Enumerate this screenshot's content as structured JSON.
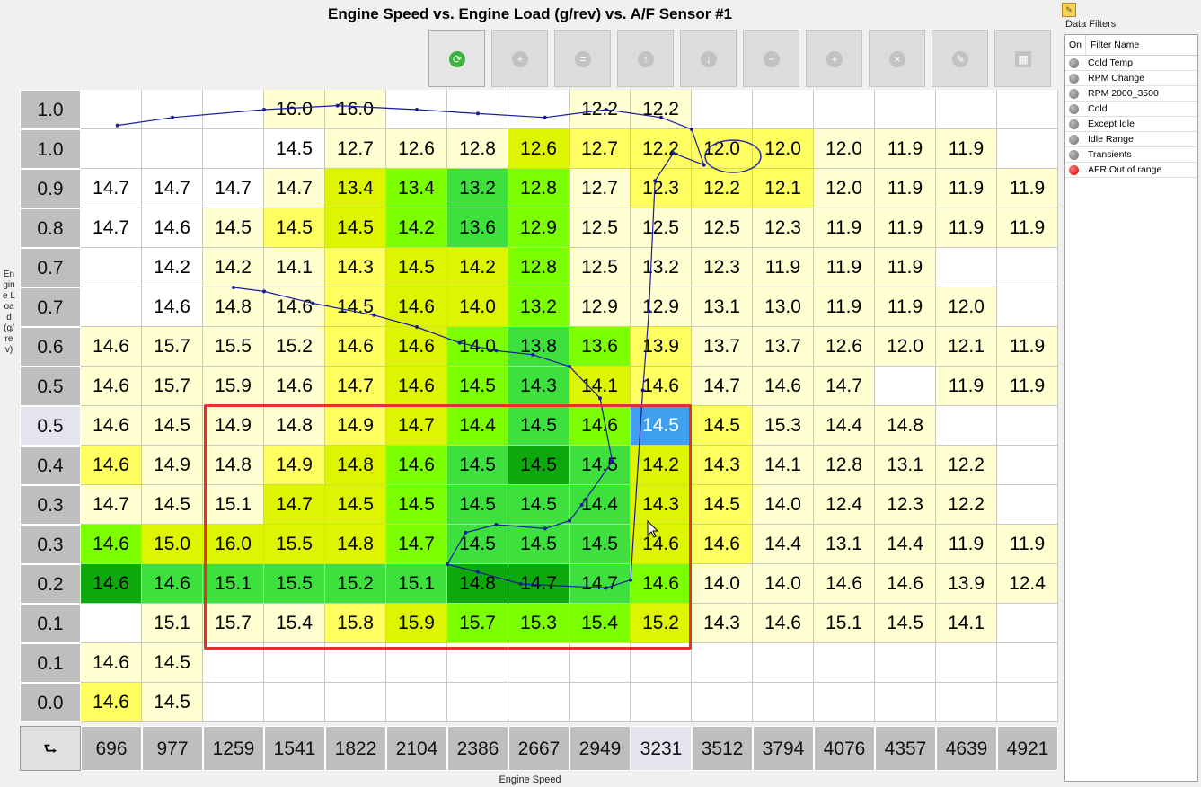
{
  "title": "Engine Speed vs. Engine Load  (g/rev) vs. A/F Sensor #1",
  "y_axis_label": "Engine Load (g/rev)",
  "x_axis_label": "Engine Speed",
  "corner_symbol": "⮑",
  "toolbar_buttons": [
    {
      "name": "refresh",
      "icon": "refresh-icon",
      "glyph": "⟳",
      "enabled": true
    },
    {
      "name": "add",
      "icon": "add-icon",
      "glyph": "+",
      "enabled": false
    },
    {
      "name": "equals",
      "icon": "equals-icon",
      "glyph": "=",
      "enabled": false
    },
    {
      "name": "move-up",
      "icon": "arrow-up-icon",
      "glyph": "↑",
      "enabled": false
    },
    {
      "name": "move-down",
      "icon": "arrow-down-icon",
      "glyph": "↓",
      "enabled": false
    },
    {
      "name": "subtract",
      "icon": "minus-icon",
      "glyph": "−",
      "enabled": false
    },
    {
      "name": "increase",
      "icon": "plus-icon",
      "glyph": "+",
      "enabled": false
    },
    {
      "name": "clear",
      "icon": "close-icon",
      "glyph": "×",
      "enabled": false
    },
    {
      "name": "edit",
      "icon": "pencil-icon",
      "glyph": "✎",
      "enabled": false
    },
    {
      "name": "table",
      "icon": "table-icon",
      "glyph": "▦",
      "enabled": false
    }
  ],
  "row_labels": [
    "1.0",
    "1.0",
    "0.9",
    "0.8",
    "0.7",
    "0.7",
    "0.6",
    "0.5",
    "0.5",
    "0.4",
    "0.3",
    "0.3",
    "0.2",
    "0.1",
    "0.1",
    "0.0"
  ],
  "col_labels": [
    "696",
    "977",
    "1259",
    "1541",
    "1822",
    "2104",
    "2386",
    "2667",
    "2949",
    "3231",
    "3512",
    "3794",
    "4076",
    "4357",
    "4639",
    "4921"
  ],
  "highlight_row": 8,
  "highlight_col": 9,
  "cells": [
    [
      "",
      "",
      "",
      "16.0",
      "16.0",
      "",
      "",
      "",
      "12.2",
      "12.2",
      "",
      "",
      "",
      "",
      "",
      ""
    ],
    [
      "",
      "",
      "",
      "14.5",
      "12.7",
      "12.6",
      "12.8",
      "12.6",
      "12.7",
      "12.2",
      "12.0",
      "12.0",
      "12.0",
      "11.9",
      "11.9",
      ""
    ],
    [
      "14.7",
      "14.7",
      "14.7",
      "14.7",
      "13.4",
      "13.4",
      "13.2",
      "12.8",
      "12.7",
      "12.3",
      "12.2",
      "12.1",
      "12.0",
      "11.9",
      "11.9",
      "11.9"
    ],
    [
      "14.7",
      "14.6",
      "14.5",
      "14.5",
      "14.5",
      "14.2",
      "13.6",
      "12.9",
      "12.5",
      "12.5",
      "12.5",
      "12.3",
      "11.9",
      "11.9",
      "11.9",
      "11.9"
    ],
    [
      "",
      "14.2",
      "14.2",
      "14.1",
      "14.3",
      "14.5",
      "14.2",
      "12.8",
      "12.5",
      "13.2",
      "12.3",
      "11.9",
      "11.9",
      "11.9",
      "",
      ""
    ],
    [
      "",
      "14.6",
      "14.8",
      "14.6",
      "14.5",
      "14.6",
      "14.0",
      "13.2",
      "12.9",
      "12.9",
      "13.1",
      "13.0",
      "11.9",
      "11.9",
      "12.0",
      ""
    ],
    [
      "14.6",
      "15.7",
      "15.5",
      "15.2",
      "14.6",
      "14.6",
      "14.0",
      "13.8",
      "13.6",
      "13.9",
      "13.7",
      "13.7",
      "12.6",
      "12.0",
      "12.1",
      "11.9"
    ],
    [
      "14.6",
      "15.7",
      "15.9",
      "14.6",
      "14.7",
      "14.6",
      "14.5",
      "14.3",
      "14.1",
      "14.6",
      "14.7",
      "14.6",
      "14.7",
      "",
      "11.9",
      "11.9"
    ],
    [
      "14.6",
      "14.5",
      "14.9",
      "14.8",
      "14.9",
      "14.7",
      "14.4",
      "14.5",
      "14.6",
      "14.5",
      "14.5",
      "15.3",
      "14.4",
      "14.8",
      "",
      ""
    ],
    [
      "14.6",
      "14.9",
      "14.8",
      "14.9",
      "14.8",
      "14.6",
      "14.5",
      "14.5",
      "14.5",
      "14.2",
      "14.3",
      "14.1",
      "12.8",
      "13.1",
      "12.2",
      ""
    ],
    [
      "14.7",
      "14.5",
      "15.1",
      "14.7",
      "14.5",
      "14.5",
      "14.5",
      "14.5",
      "14.4",
      "14.3",
      "14.5",
      "14.0",
      "12.4",
      "12.3",
      "12.2",
      ""
    ],
    [
      "14.6",
      "15.0",
      "16.0",
      "15.5",
      "14.8",
      "14.7",
      "14.5",
      "14.5",
      "14.5",
      "14.6",
      "14.6",
      "14.4",
      "13.1",
      "14.4",
      "11.9",
      "11.9"
    ],
    [
      "14.6",
      "14.6",
      "15.1",
      "15.5",
      "15.2",
      "15.1",
      "14.8",
      "14.7",
      "14.7",
      "14.6",
      "14.0",
      "14.0",
      "14.6",
      "14.6",
      "13.9",
      "12.4"
    ],
    [
      "",
      "15.1",
      "15.7",
      "15.4",
      "15.8",
      "15.9",
      "15.7",
      "15.3",
      "15.4",
      "15.2",
      "14.3",
      "14.6",
      "15.1",
      "14.5",
      "14.1",
      ""
    ],
    [
      "14.6",
      "14.5",
      "",
      "",
      "",
      "",
      "",
      "",
      "",
      "",
      "",
      "",
      "",
      "",
      "",
      ""
    ],
    [
      "14.6",
      "14.5",
      "",
      "",
      "",
      "",
      "",
      "",
      "",
      "",
      "",
      "",
      "",
      "",
      "",
      ""
    ]
  ],
  "colors": {
    "white": "#ffffff",
    "pale": "#ffffd2",
    "yellow": "#ffff62",
    "yellowbright": "#ffff00",
    "lime": "#ddf500",
    "limelight": "#ccff33",
    "greenlight": "#7cff00",
    "green": "#3de03d",
    "greenmid": "#22cc22",
    "greendark": "#0ca80c",
    "selected": "#3f9eed",
    "trace": "#1a1aa0",
    "box": "#e53030"
  },
  "color_map": [
    [
      "W",
      "W",
      "W",
      "P",
      "P",
      "W",
      "W",
      "W",
      "P",
      "P",
      "W",
      "W",
      "W",
      "W",
      "W",
      "W"
    ],
    [
      "W",
      "W",
      "W",
      "W",
      "P",
      "P",
      "P",
      "L",
      "Y",
      "Y",
      "Y",
      "Y",
      "P",
      "P",
      "P",
      "W"
    ],
    [
      "W",
      "W",
      "W",
      "P",
      "L",
      "G",
      "g",
      "G",
      "P",
      "Y",
      "Y",
      "Y",
      "P",
      "P",
      "P",
      "P"
    ],
    [
      "W",
      "W",
      "P",
      "Y",
      "L",
      "G",
      "g",
      "G",
      "P",
      "P",
      "P",
      "P",
      "P",
      "P",
      "P",
      "P"
    ],
    [
      "W",
      "W",
      "P",
      "P",
      "Y",
      "L",
      "L",
      "G",
      "P",
      "P",
      "P",
      "P",
      "P",
      "P",
      "W",
      "W"
    ],
    [
      "W",
      "W",
      "P",
      "P",
      "Y",
      "L",
      "L",
      "G",
      "P",
      "P",
      "P",
      "P",
      "P",
      "P",
      "P",
      "W"
    ],
    [
      "P",
      "P",
      "P",
      "P",
      "Y",
      "L",
      "G",
      "g",
      "G",
      "Y",
      "P",
      "P",
      "P",
      "P",
      "P",
      "P"
    ],
    [
      "P",
      "P",
      "P",
      "P",
      "Y",
      "L",
      "G",
      "g",
      "L",
      "Y",
      "P",
      "P",
      "P",
      "W",
      "P",
      "P"
    ],
    [
      "P",
      "P",
      "P",
      "P",
      "Y",
      "L",
      "G",
      "g",
      "G",
      "S",
      "Y",
      "P",
      "P",
      "P",
      "W",
      "W"
    ],
    [
      "Y",
      "P",
      "P",
      "Y",
      "L",
      "G",
      "g",
      "D",
      "g",
      "L",
      "Y",
      "P",
      "P",
      "P",
      "P",
      "W"
    ],
    [
      "P",
      "P",
      "P",
      "L",
      "L",
      "G",
      "g",
      "g",
      "g",
      "L",
      "Y",
      "P",
      "P",
      "P",
      "P",
      "W"
    ],
    [
      "G",
      "L",
      "L",
      "L",
      "L",
      "G",
      "g",
      "g",
      "g",
      "L",
      "Y",
      "P",
      "P",
      "P",
      "P",
      "P"
    ],
    [
      "D",
      "g",
      "g",
      "g",
      "g",
      "g",
      "D",
      "D",
      "g",
      "G",
      "P",
      "P",
      "P",
      "P",
      "P",
      "P"
    ],
    [
      "W",
      "P",
      "P",
      "P",
      "Y",
      "L",
      "G",
      "G",
      "G",
      "L",
      "P",
      "P",
      "P",
      "P",
      "P",
      "W"
    ],
    [
      "P",
      "P",
      "W",
      "W",
      "W",
      "W",
      "W",
      "W",
      "W",
      "W",
      "W",
      "W",
      "W",
      "W",
      "W",
      "W"
    ],
    [
      "Y",
      "P",
      "W",
      "W",
      "W",
      "W",
      "W",
      "W",
      "W",
      "W",
      "W",
      "W",
      "W",
      "W",
      "W",
      "W"
    ]
  ],
  "trace_path": [
    [
      [
        0.6,
        13.1
      ],
      [
        1.5,
        13.3
      ],
      [
        3.0,
        13.5
      ],
      [
        4.2,
        13.6
      ],
      [
        5.5,
        13.5
      ],
      [
        6.5,
        13.4
      ],
      [
        7.6,
        13.3
      ],
      [
        8.6,
        13.5
      ],
      [
        9.5,
        13.3
      ],
      [
        10.0,
        13.0
      ],
      [
        10.2,
        12.1
      ],
      [
        9.7,
        12.4
      ],
      [
        9.4,
        11.7
      ],
      [
        9.3,
        8.4
      ],
      [
        9.2,
        6.4
      ],
      [
        9.0,
        1.6
      ],
      [
        8.6,
        1.4
      ],
      [
        7.2,
        1.5
      ],
      [
        6.5,
        1.8
      ],
      [
        6.0,
        2.0
      ],
      [
        6.3,
        2.8
      ],
      [
        6.8,
        3.0
      ],
      [
        7.6,
        2.9
      ],
      [
        8.0,
        3.1
      ],
      [
        8.2,
        3.5
      ],
      [
        8.7,
        4.6
      ],
      [
        8.5,
        6.2
      ],
      [
        8.0,
        7.0
      ],
      [
        7.4,
        7.3
      ],
      [
        6.8,
        7.4
      ],
      [
        6.2,
        7.6
      ],
      [
        5.5,
        8.0
      ],
      [
        4.8,
        8.3
      ],
      [
        3.8,
        8.6
      ],
      [
        3.0,
        8.9
      ],
      [
        2.5,
        9.0
      ]
    ]
  ],
  "filters_title": "Data Filters",
  "filters_header": {
    "on": "On",
    "name": "Filter Name"
  },
  "filters": [
    {
      "name": "Cold Temp",
      "on": false
    },
    {
      "name": "RPM Change",
      "on": false
    },
    {
      "name": "RPM 2000_3500",
      "on": false
    },
    {
      "name": "Cold",
      "on": false
    },
    {
      "name": "Except Idle",
      "on": false
    },
    {
      "name": "Idle Range",
      "on": false
    },
    {
      "name": "Transients",
      "on": false
    },
    {
      "name": "AFR Out of range",
      "on": true
    }
  ]
}
